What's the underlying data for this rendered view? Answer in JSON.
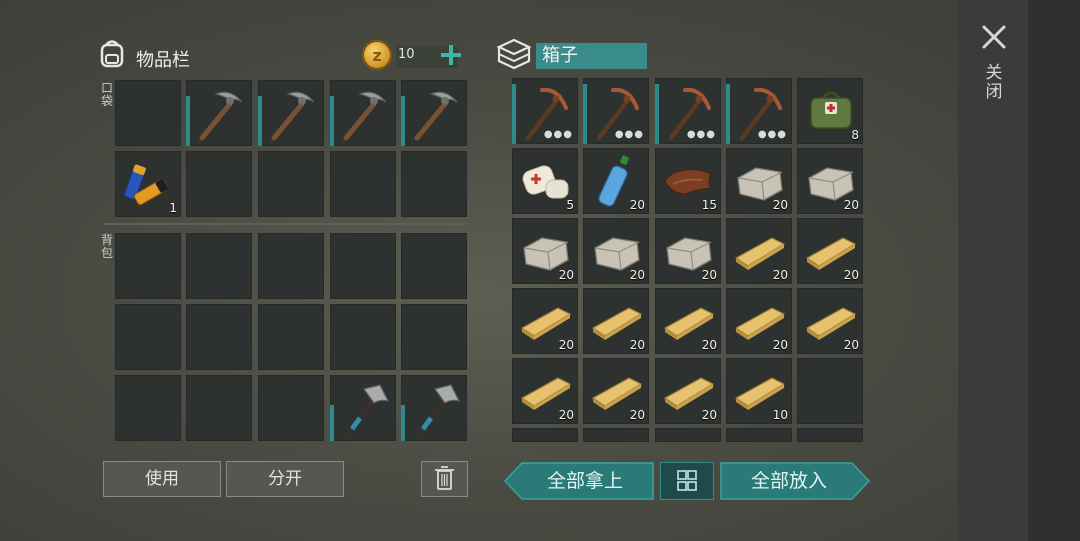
{
  "inventory": {
    "title": "物品栏",
    "coins": "10",
    "pocket_label": "口袋",
    "backpack_label": "背包"
  },
  "box": {
    "name": "箱子"
  },
  "buttons": {
    "use": "使用",
    "split": "分开",
    "take_all": "全部拿上",
    "put_all": "全部放入"
  },
  "close_label": "关闭",
  "pocket_slots": [
    {
      "item": "",
      "count": ""
    },
    {
      "item": "iron-pickaxe",
      "count": ""
    },
    {
      "item": "iron-pickaxe",
      "count": ""
    },
    {
      "item": "iron-pickaxe",
      "count": ""
    },
    {
      "item": "iron-pickaxe",
      "count": ""
    },
    {
      "item": "batteries",
      "count": "1"
    },
    {
      "item": "",
      "count": ""
    },
    {
      "item": "",
      "count": ""
    },
    {
      "item": "",
      "count": ""
    },
    {
      "item": "",
      "count": ""
    }
  ],
  "backpack_slots": [
    {
      "item": "",
      "count": ""
    },
    {
      "item": "",
      "count": ""
    },
    {
      "item": "",
      "count": ""
    },
    {
      "item": "",
      "count": ""
    },
    {
      "item": "",
      "count": ""
    },
    {
      "item": "",
      "count": ""
    },
    {
      "item": "",
      "count": ""
    },
    {
      "item": "",
      "count": ""
    },
    {
      "item": "",
      "count": ""
    },
    {
      "item": "",
      "count": ""
    },
    {
      "item": "",
      "count": ""
    },
    {
      "item": "",
      "count": ""
    },
    {
      "item": "",
      "count": ""
    },
    {
      "item": "hatchet",
      "count": ""
    },
    {
      "item": "hatchet",
      "count": ""
    }
  ],
  "box_slots": [
    {
      "item": "copper-pickaxe",
      "count": ""
    },
    {
      "item": "copper-pickaxe",
      "count": ""
    },
    {
      "item": "copper-pickaxe",
      "count": ""
    },
    {
      "item": "copper-pickaxe",
      "count": ""
    },
    {
      "item": "medkit",
      "count": "8"
    },
    {
      "item": "bandage",
      "count": "5"
    },
    {
      "item": "water-bottle",
      "count": "20"
    },
    {
      "item": "leather",
      "count": "15"
    },
    {
      "item": "stone",
      "count": "20"
    },
    {
      "item": "stone",
      "count": "20"
    },
    {
      "item": "stone",
      "count": "20"
    },
    {
      "item": "stone",
      "count": "20"
    },
    {
      "item": "stone",
      "count": "20"
    },
    {
      "item": "plank",
      "count": "20"
    },
    {
      "item": "plank",
      "count": "20"
    },
    {
      "item": "plank",
      "count": "20"
    },
    {
      "item": "plank",
      "count": "20"
    },
    {
      "item": "plank",
      "count": "20"
    },
    {
      "item": "plank",
      "count": "20"
    },
    {
      "item": "plank",
      "count": "20"
    },
    {
      "item": "plank",
      "count": "20"
    },
    {
      "item": "plank",
      "count": "20"
    },
    {
      "item": "plank",
      "count": "20"
    },
    {
      "item": "plank",
      "count": "10"
    },
    {
      "item": "",
      "count": ""
    }
  ],
  "colors": {
    "accent": "#2f9c9a",
    "slot": "#2d3130"
  }
}
